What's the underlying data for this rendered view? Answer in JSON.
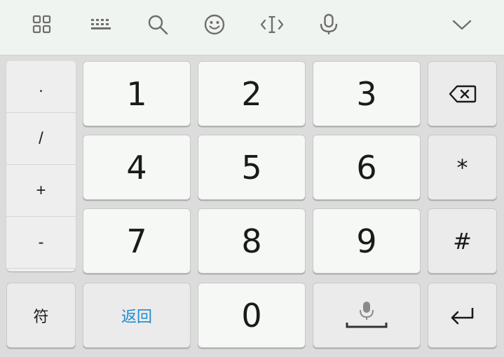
{
  "toolbar": {
    "icons": [
      "grid-icon",
      "keyboard-icon",
      "search-icon",
      "emoji-icon",
      "cursor-icon",
      "microphone-icon",
      "chevron-down-icon"
    ]
  },
  "side_panel": {
    "items": [
      ".",
      "/",
      "+",
      "-"
    ]
  },
  "keys": {
    "k1": "1",
    "k2": "2",
    "k3": "3",
    "k4": "4",
    "k5": "5",
    "k6": "6",
    "k7": "7",
    "k8": "8",
    "k9": "9",
    "k0": "0",
    "star": "*",
    "hash": "#",
    "symbols": "符",
    "back": "返回"
  },
  "colors": {
    "toolbar_bg": "#f0f4f0",
    "key_light": "#f5f8f5",
    "key_gray": "#ebebeb",
    "accent_blue": "#1e8ad0"
  }
}
